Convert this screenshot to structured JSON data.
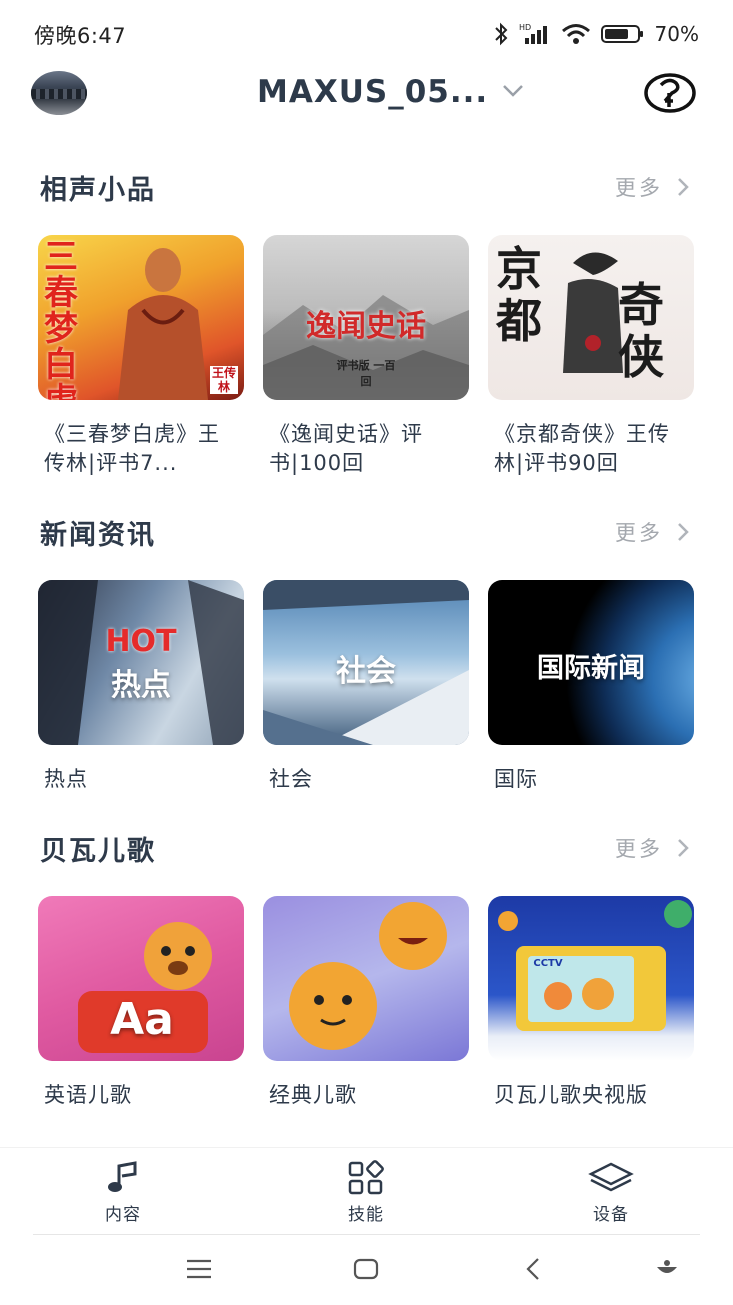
{
  "status_bar": {
    "time": "傍晚6:47",
    "battery_percent": "70%"
  },
  "header": {
    "device_name": "MAXUS_05..."
  },
  "sections": [
    {
      "title": "相声小品",
      "more_label": "更多",
      "cards": [
        {
          "title": "《三春梦白虎》王传林|评书7...",
          "art_text": "三春梦白虎",
          "art_sub": "王传林"
        },
        {
          "title": "《逸闻史话》评书|100回",
          "art_text": "逸闻史话",
          "art_sub": "评书版 一百回"
        },
        {
          "title": "《京都奇侠》王传林|评书90回",
          "art_text_left": "京都",
          "art_text_right": "奇侠"
        }
      ]
    },
    {
      "title": "新闻资讯",
      "more_label": "更多",
      "cards": [
        {
          "title": "热点",
          "art_text_top": "HOT",
          "art_text": "热点"
        },
        {
          "title": "社会",
          "art_text": "社会"
        },
        {
          "title": "国际",
          "art_text": "国际新闻"
        }
      ]
    },
    {
      "title": "贝瓦儿歌",
      "more_label": "更多",
      "cards": [
        {
          "title": "英语儿歌",
          "art_text": "Aa"
        },
        {
          "title": "经典儿歌"
        },
        {
          "title": "贝瓦儿歌央视版",
          "art_text": "CCTV"
        }
      ]
    }
  ],
  "tabs": [
    {
      "label": "内容",
      "icon": "music-note-icon"
    },
    {
      "label": "技能",
      "icon": "apps-grid-icon"
    },
    {
      "label": "设备",
      "icon": "layers-icon"
    }
  ],
  "colors": {
    "text_primary": "#2e3a4a",
    "text_muted": "#a4a8ae"
  }
}
